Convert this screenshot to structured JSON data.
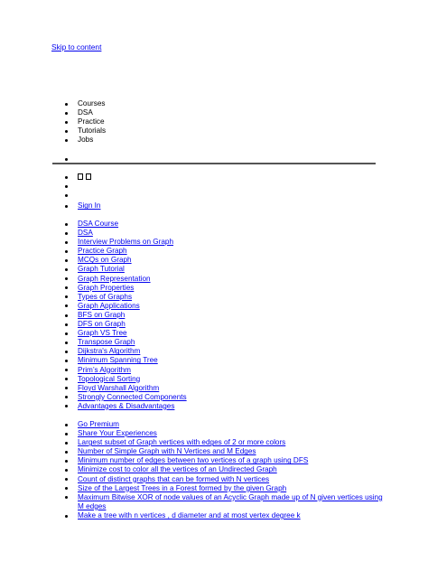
{
  "skip_link": "Skip to content",
  "nav": [
    "Courses",
    "DSA",
    "Practice",
    "Tutorials",
    "Jobs"
  ],
  "sign_in": "Sign In",
  "crumbs": [
    "DSA Course",
    "DSA",
    "Interview Problems on Graph",
    "Practice Graph",
    "MCQs on Graph",
    "Graph Tutorial",
    "Graph Representation",
    "Graph Properties",
    "Types of Graphs",
    "Graph Applications",
    "BFS on Graph",
    "DFS on Graph",
    "Graph VS Tree",
    "Transpose Graph",
    "Dijkstra's Algorithm",
    "Minimum Spanning Tree",
    "Prim’s Algorithm",
    "Topological Sorting",
    "Floyd Warshall Algorithm",
    "Strongly Connected Components",
    "Advantages & Disadvantages"
  ],
  "more": [
    "Go Premium",
    "Share Your Experiences",
    "Largest subset of Graph vertices with edges of 2 or more colors",
    "Number of Simple Graph with N Vertices and M Edges",
    "Minimum number of edges between two vertices of a graph using DFS",
    "Minimize cost to color all the vertices of an Undirected Graph",
    "Count of distinct graphs that can be formed with N vertices",
    "Size of the Largest Trees in a Forest formed by the given Graph",
    "Maximum Bitwise XOR of node values of an Acyclic Graph made up of N given vertices using M edges",
    "Make a tree with n vertices , d diameter and at most vertex degree k"
  ]
}
